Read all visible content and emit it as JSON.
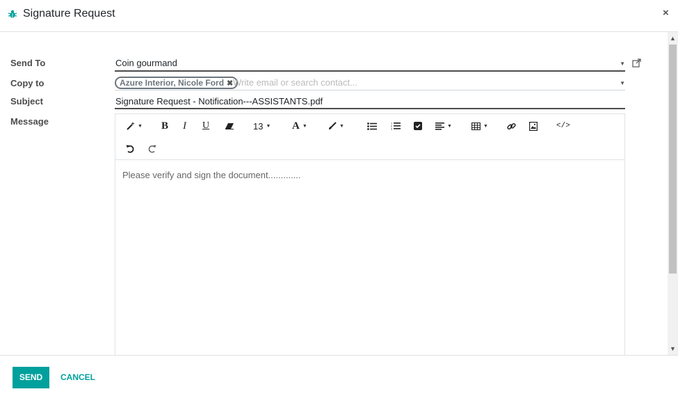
{
  "dialog": {
    "title": "Signature Request",
    "close_symbol": "×"
  },
  "form": {
    "send_to": {
      "label": "Send To",
      "value": "Coin gourmand"
    },
    "copy_to": {
      "label": "Copy to",
      "tags": [
        "Azure Interior, Nicole Ford"
      ],
      "placeholder": "Write email or search contact..."
    },
    "subject": {
      "label": "Subject",
      "value": "Signature Request - Notification---ASSISTANTS.pdf"
    },
    "message": {
      "label": "Message",
      "body": "Please verify and sign the document............."
    }
  },
  "toolbar": {
    "font_size": "13",
    "icons": [
      "magic-wand-icon",
      "bold-icon",
      "italic-icon",
      "underline-icon",
      "eraser-icon",
      "font-size-dropdown",
      "font-color-icon",
      "brush-icon",
      "bullet-list-icon",
      "numbered-list-icon",
      "checklist-icon",
      "align-icon",
      "table-icon",
      "link-icon",
      "image-icon",
      "code-view-icon",
      "undo-icon",
      "redo-icon"
    ]
  },
  "footer": {
    "send_label": "SEND",
    "cancel_label": "CANCEL"
  },
  "colors": {
    "accent": "#00a09d",
    "bug_icon": "#00a09d"
  }
}
